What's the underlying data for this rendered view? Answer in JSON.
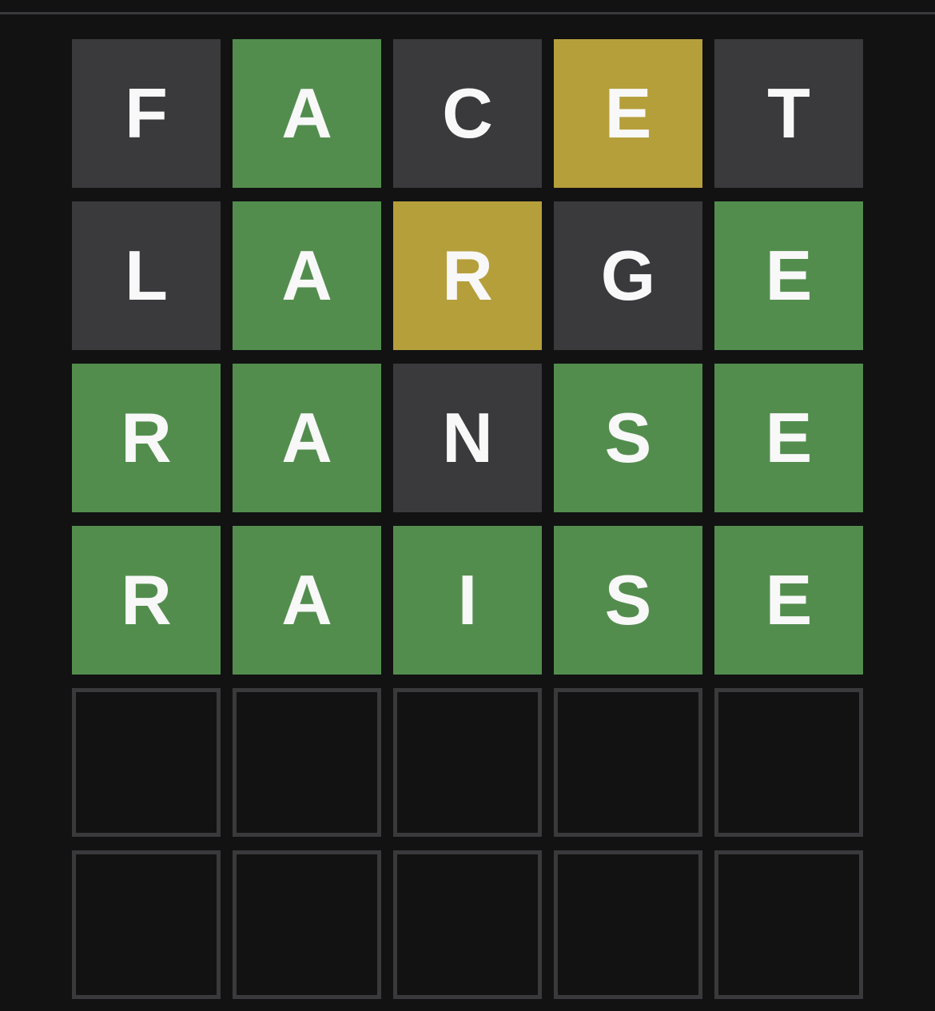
{
  "colors": {
    "background": "#121213",
    "correct": "#538d4e",
    "present": "#b59f3b",
    "absent": "#3a3a3c",
    "empty_border": "#3a3a3c",
    "letter": "#f8f8f8"
  },
  "board": {
    "rows": [
      {
        "tiles": [
          {
            "letter": "F",
            "state": "absent"
          },
          {
            "letter": "A",
            "state": "correct"
          },
          {
            "letter": "C",
            "state": "absent"
          },
          {
            "letter": "E",
            "state": "present"
          },
          {
            "letter": "T",
            "state": "absent"
          }
        ]
      },
      {
        "tiles": [
          {
            "letter": "L",
            "state": "absent"
          },
          {
            "letter": "A",
            "state": "correct"
          },
          {
            "letter": "R",
            "state": "present"
          },
          {
            "letter": "G",
            "state": "absent"
          },
          {
            "letter": "E",
            "state": "correct"
          }
        ]
      },
      {
        "tiles": [
          {
            "letter": "R",
            "state": "correct"
          },
          {
            "letter": "A",
            "state": "correct"
          },
          {
            "letter": "N",
            "state": "absent"
          },
          {
            "letter": "S",
            "state": "correct"
          },
          {
            "letter": "E",
            "state": "correct"
          }
        ]
      },
      {
        "tiles": [
          {
            "letter": "R",
            "state": "correct"
          },
          {
            "letter": "A",
            "state": "correct"
          },
          {
            "letter": "I",
            "state": "correct"
          },
          {
            "letter": "S",
            "state": "correct"
          },
          {
            "letter": "E",
            "state": "correct"
          }
        ]
      },
      {
        "tiles": [
          {
            "letter": "",
            "state": "empty"
          },
          {
            "letter": "",
            "state": "empty"
          },
          {
            "letter": "",
            "state": "empty"
          },
          {
            "letter": "",
            "state": "empty"
          },
          {
            "letter": "",
            "state": "empty"
          }
        ]
      },
      {
        "tiles": [
          {
            "letter": "",
            "state": "empty"
          },
          {
            "letter": "",
            "state": "empty"
          },
          {
            "letter": "",
            "state": "empty"
          },
          {
            "letter": "",
            "state": "empty"
          },
          {
            "letter": "",
            "state": "empty"
          }
        ]
      }
    ]
  }
}
